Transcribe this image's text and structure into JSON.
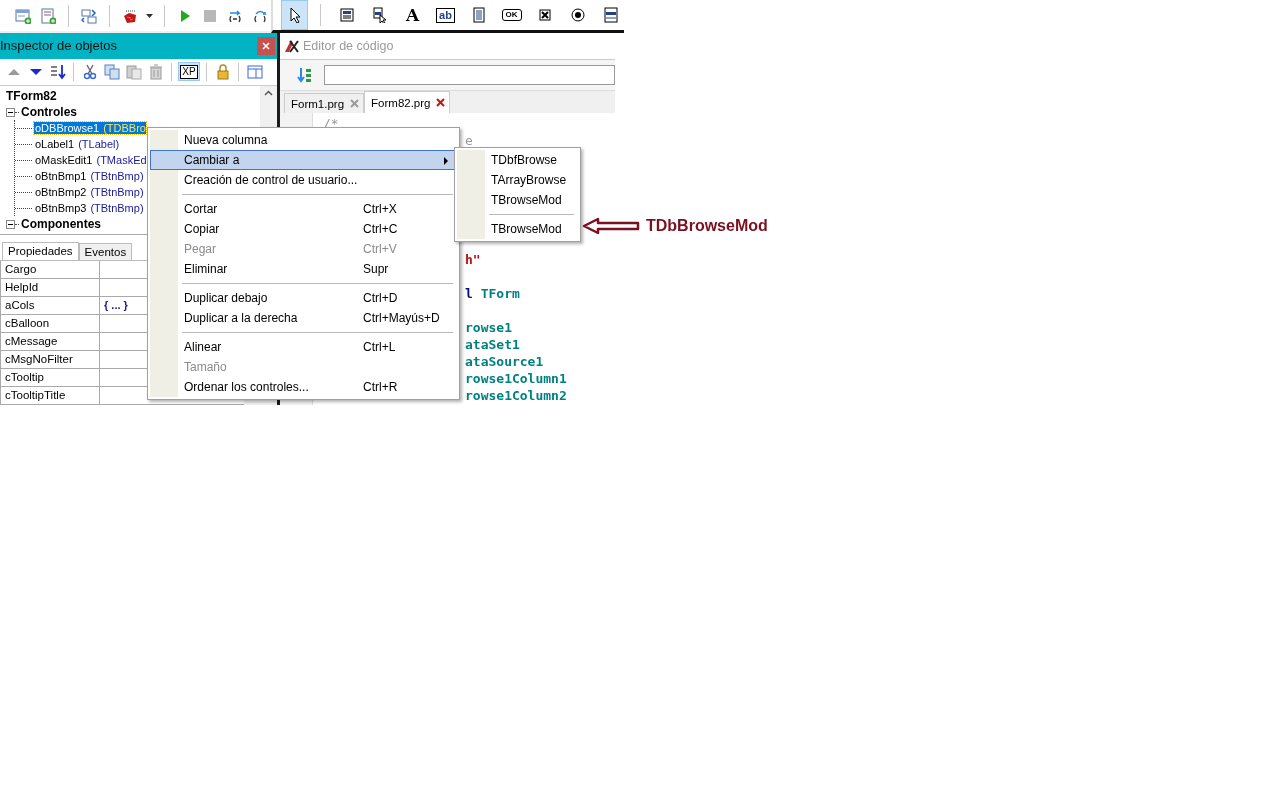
{
  "toolbar": {
    "palette": [
      {
        "selected": true
      },
      {
        "selected": false
      },
      {
        "selected": false
      },
      {
        "selected": false,
        "label": "A"
      },
      {
        "selected": false,
        "label": "ab"
      },
      {
        "selected": false
      },
      {
        "selected": false,
        "label": "OK"
      },
      {
        "selected": false
      },
      {
        "selected": false
      },
      {
        "selected": false
      }
    ]
  },
  "inspector": {
    "title": "Inspector de objetos",
    "tools": [
      {
        "selected": false
      },
      {
        "selected": false
      },
      {
        "selected": false
      },
      {
        "selected": false
      },
      {
        "selected": false
      },
      {
        "selected": false
      },
      {
        "selected": false
      },
      {
        "selected": true,
        "label": "XP"
      },
      {
        "selected": false
      },
      {
        "selected": false
      }
    ],
    "tree": [
      {
        "label": "TForm82",
        "children": [
          {
            "label": "Controles",
            "expanded": true,
            "children": [
              {
                "name": "oDBBrowse1",
                "type": "(TDBBro",
                "selected": true
              },
              {
                "name": "oLabel1",
                "type": "(TLabel)",
                "selected": false
              },
              {
                "name": "oMaskEdit1",
                "type": "(TMaskEd",
                "selected": false
              },
              {
                "name": "oBtnBmp1",
                "type": "(TBtnBmp)",
                "selected": false
              },
              {
                "name": "oBtnBmp2",
                "type": "(TBtnBmp)",
                "selected": false
              },
              {
                "name": "oBtnBmp3",
                "type": "(TBtnBmp)",
                "selected": false
              }
            ]
          },
          {
            "label": "Componentes",
            "expanded": true
          }
        ]
      }
    ],
    "tabs": [
      {
        "label": "Propiedades",
        "selected": true
      },
      {
        "label": "Eventos",
        "selected": false
      }
    ],
    "properties": [
      {
        "name": "Cargo"
      },
      {
        "name": "HelpId"
      },
      {
        "name": "aCols",
        "value": "{ ... }"
      },
      {
        "name": "cBalloon"
      },
      {
        "name": "cMessage"
      },
      {
        "name": "cMsgNoFilter"
      },
      {
        "name": "cTooltip"
      },
      {
        "name": "cTooltipTitle"
      }
    ]
  },
  "editor": {
    "title": "Editor de código",
    "tabs": [
      {
        "label": "Form1.prg",
        "selected": false
      },
      {
        "label": "Form82.prg",
        "selected": true
      }
    ],
    "lines": [
      {
        "kind": "full",
        "parts": [
          {
            "text": "/*",
            "kind": "comment"
          }
        ]
      },
      {
        "kind": "tail",
        "parts": [
          {
            "text": "e",
            "kind": "comment"
          }
        ]
      },
      {
        "kind": "blank"
      },
      {
        "kind": "blank"
      },
      {
        "kind": "blank"
      },
      {
        "kind": "blank"
      },
      {
        "kind": "blank"
      },
      {
        "kind": "blank"
      },
      {
        "kind": "tail",
        "parts": [
          {
            "text": "h\"",
            "kind": "string"
          }
        ]
      },
      {
        "kind": "blank"
      },
      {
        "kind": "tail",
        "parts": [
          {
            "text": "l",
            "kind": "keyword"
          },
          {
            "text": " TForm",
            "kind": "class"
          }
        ]
      },
      {
        "kind": "blank"
      },
      {
        "kind": "tail",
        "parts": [
          {
            "text": "rowse1",
            "kind": "class"
          }
        ]
      },
      {
        "kind": "tail",
        "parts": [
          {
            "text": "ataSet1",
            "kind": "class"
          }
        ]
      },
      {
        "kind": "tail",
        "parts": [
          {
            "text": "ataSource1",
            "kind": "class"
          }
        ]
      },
      {
        "kind": "tail",
        "parts": [
          {
            "text": "rowse1Column1",
            "kind": "class"
          }
        ]
      },
      {
        "kind": "tail",
        "parts": [
          {
            "text": "rowse1Column2",
            "kind": "class"
          }
        ]
      }
    ]
  },
  "context_menu": {
    "items": [
      {
        "kind": "item",
        "label": "Nueva columna",
        "disabled": false,
        "selected": false
      },
      {
        "kind": "submenu",
        "label": "Cambiar a",
        "disabled": false,
        "selected": true
      },
      {
        "kind": "item",
        "label": "Creación de control de usuario...",
        "disabled": false,
        "selected": false
      },
      {
        "kind": "separator"
      },
      {
        "kind": "item",
        "label": "Cortar",
        "shortcut": "Ctrl+X",
        "disabled": false,
        "selected": false
      },
      {
        "kind": "item",
        "label": "Copiar",
        "shortcut": "Ctrl+C",
        "disabled": false,
        "selected": false
      },
      {
        "kind": "item",
        "label": "Pegar",
        "shortcut": "Ctrl+V",
        "disabled": true,
        "selected": false
      },
      {
        "kind": "item",
        "label": "Eliminar",
        "shortcut": "Supr",
        "disabled": false,
        "selected": false
      },
      {
        "kind": "separator"
      },
      {
        "kind": "item",
        "label": "Duplicar debajo",
        "shortcut": "Ctrl+D",
        "disabled": false,
        "selected": false
      },
      {
        "kind": "item",
        "label": "Duplicar a la derecha",
        "shortcut": "Ctrl+Mayús+D",
        "disabled": false,
        "selected": false
      },
      {
        "kind": "separator"
      },
      {
        "kind": "item",
        "label": "Alinear",
        "shortcut": "Ctrl+L",
        "disabled": false,
        "selected": false
      },
      {
        "kind": "item",
        "label": "Tamaño",
        "disabled": true,
        "selected": false
      },
      {
        "kind": "item",
        "label": "Ordenar los controles...",
        "shortcut": "Ctrl+R",
        "disabled": false,
        "selected": false
      }
    ]
  },
  "submenu": {
    "items": [
      {
        "kind": "item",
        "label": "TDbfBrowse",
        "disabled": false,
        "selected": false
      },
      {
        "kind": "item",
        "label": "TArrayBrowse",
        "disabled": false,
        "selected": false
      },
      {
        "kind": "item",
        "label": "TBrowseMod",
        "disabled": false,
        "selected": false
      },
      {
        "kind": "separator"
      },
      {
        "kind": "item",
        "label": "TBrowseMod",
        "disabled": false,
        "selected": false
      }
    ]
  },
  "annotation": {
    "label": "TDbBrowseMod"
  }
}
